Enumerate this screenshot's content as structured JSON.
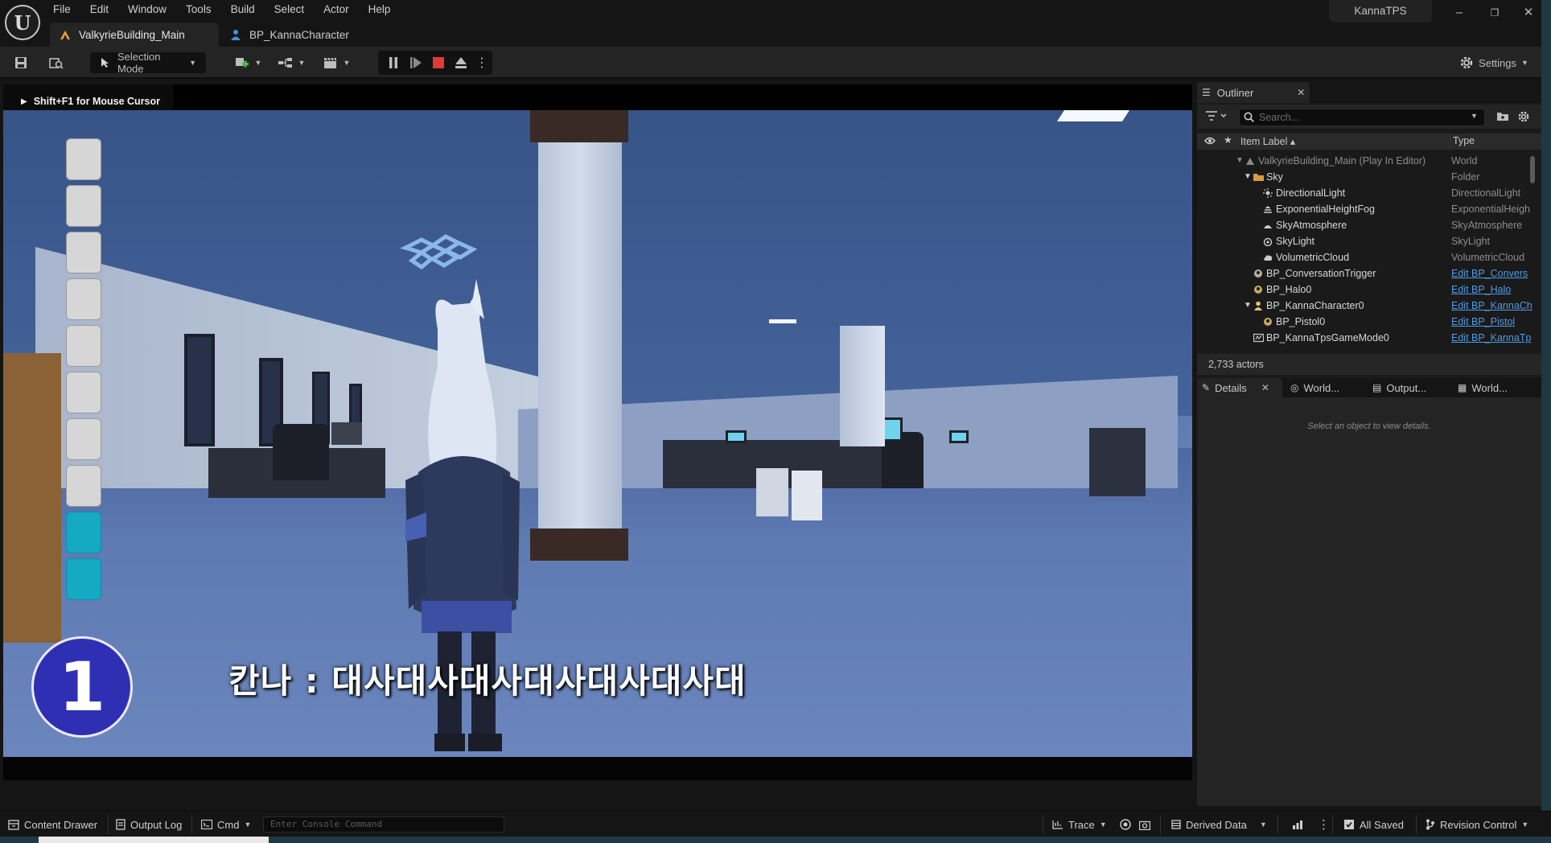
{
  "menu": {
    "items": [
      "File",
      "Edit",
      "Window",
      "Tools",
      "Build",
      "Select",
      "Actor",
      "Help"
    ]
  },
  "project_name": "KannaTPS",
  "window_controls": {
    "minimize": "–",
    "restore": "❐",
    "close": "✕"
  },
  "doc_tabs": [
    {
      "label": "ValkyrieBuilding_Main",
      "icon": "level-icon",
      "active": true
    },
    {
      "label": "BP_KannaCharacter",
      "icon": "blueprint-person-icon",
      "active": false
    }
  ],
  "toolbar": {
    "selection_mode": "Selection Mode",
    "settings": "Settings",
    "stop_color": "#e33838"
  },
  "viewport": {
    "hint": "Shift+F1 for Mouse Cursor",
    "subtitle": "칸나 : 대사대사대사대사대사대사대",
    "ammo_count": "1",
    "ammo_slots_total": 10,
    "ammo_slots_filled": 2
  },
  "outliner": {
    "tab_label": "Outliner",
    "search_placeholder": "Search...",
    "col_label": "Item Label ▴",
    "col_type": "Type",
    "rows": [
      {
        "label": "ValkyrieBuilding_Main (Play In Editor)",
        "type": "World",
        "dim": true
      },
      {
        "label": "Sky",
        "type": "Folder"
      },
      {
        "label": "DirectionalLight",
        "type": "DirectionalLight"
      },
      {
        "label": "ExponentialHeightFog",
        "type": "ExponentialHeigh"
      },
      {
        "label": "SkyAtmosphere",
        "type": "SkyAtmosphere"
      },
      {
        "label": "SkyLight",
        "type": "SkyLight"
      },
      {
        "label": "VolumetricCloud",
        "type": "VolumetricCloud"
      },
      {
        "label": "BP_ConversationTrigger",
        "type": "Edit BP_Convers"
      },
      {
        "label": "BP_Halo0",
        "type": "Edit BP_Halo"
      },
      {
        "label": "BP_KannaCharacter0",
        "type": "Edit BP_KannaCh"
      },
      {
        "label": "BP_Pistol0",
        "type": "Edit BP_Pistol"
      },
      {
        "label": "BP_KannaTpsGameMode0",
        "type": "Edit BP_KannaTp"
      }
    ],
    "actor_count": "2,733 actors"
  },
  "details_tabs": [
    {
      "label": "Details",
      "active": true
    },
    {
      "label": "World...",
      "active": false
    },
    {
      "label": "Output...",
      "active": false
    },
    {
      "label": "World...",
      "active": false
    }
  ],
  "details": {
    "empty_message": "Select an object to view details."
  },
  "statusbar": {
    "content_drawer": "Content Drawer",
    "output_log": "Output Log",
    "cmd": "Cmd",
    "console_placeholder": "Enter Console Command",
    "trace": "Trace",
    "derived_data": "Derived Data",
    "all_saved": "All Saved",
    "revision_control": "Revision Control"
  }
}
